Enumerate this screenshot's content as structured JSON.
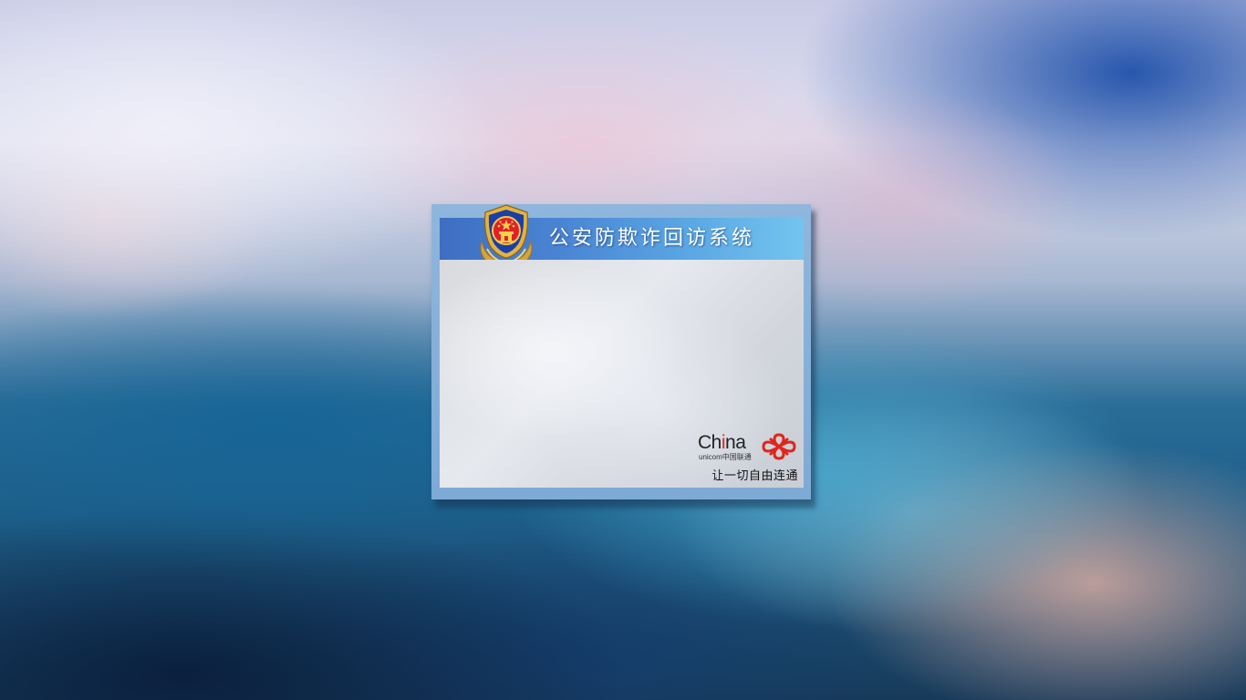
{
  "window": {
    "title": "公安防欺诈回访系统"
  },
  "emblem": {
    "icon": "police-emblem-icon"
  },
  "brand": {
    "word_prefix": "Ch",
    "word_accent": "i",
    "word_suffix": "na",
    "sub": "unicom中国联通",
    "slogan": "让一切自由连通",
    "icon": "unicom-knot-icon"
  },
  "colors": {
    "title_bar_start": "#3e6ec2",
    "title_bar_end": "#74c4ef",
    "frame": "#8fb6dc",
    "brand_red": "#e1251b"
  }
}
